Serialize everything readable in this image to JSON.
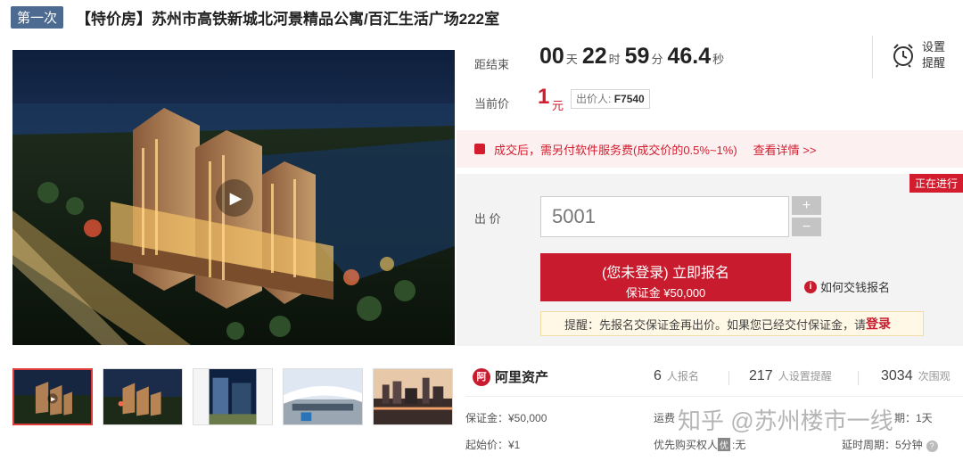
{
  "title": {
    "round_badge": "第一次",
    "text": "【特价房】苏州市高铁新城北河景精品公寓/百汇生活广场222室"
  },
  "countdown": {
    "label": "距结束",
    "days": "00",
    "days_unit": "天",
    "hours": "22",
    "hours_unit": "时",
    "minutes": "59",
    "minutes_unit": "分",
    "seconds": "46.4",
    "seconds_unit": "秒"
  },
  "reminder_set": {
    "line1": "设置",
    "line2": "提醒",
    "icon": "alarm-clock-icon"
  },
  "current_price": {
    "label": "当前价",
    "value": "1",
    "unit": "元",
    "bidder_label": "出价人:",
    "bidder_id": "F7540"
  },
  "fee_notice": {
    "text": "成交后，需另付软件服务费(成交价的0.5%~1%)",
    "link": "查看详情 >>"
  },
  "bid": {
    "status": "正在进行",
    "label": "出 价",
    "input_value": "5001",
    "plus": "+",
    "minus": "−",
    "signup_line1": "(您未登录) 立即报名",
    "signup_line2": "保证金 ¥50,000",
    "howto": "如何交钱报名",
    "reminder_text": "提醒：先报名交保证金再出价。如果您已经交付保证金，请",
    "reminder_login": "登录"
  },
  "stats": {
    "brand": "阿里资产",
    "signups": "6",
    "signups_label": "人报名",
    "reminders": "217",
    "reminders_label": "人设置提醒",
    "views": "3034",
    "views_label": "次围观"
  },
  "details": {
    "deposit": "保证金：¥50,000",
    "start_price": "起始价：¥1",
    "shipping": "运费",
    "priority_label": "优先购买权人",
    "priority_badge": "优",
    "priority_value": ":无",
    "period_partial": "期：1天",
    "delay_period": "延时周期：5分钟"
  },
  "watermark": "知乎 @苏州楼市一线"
}
